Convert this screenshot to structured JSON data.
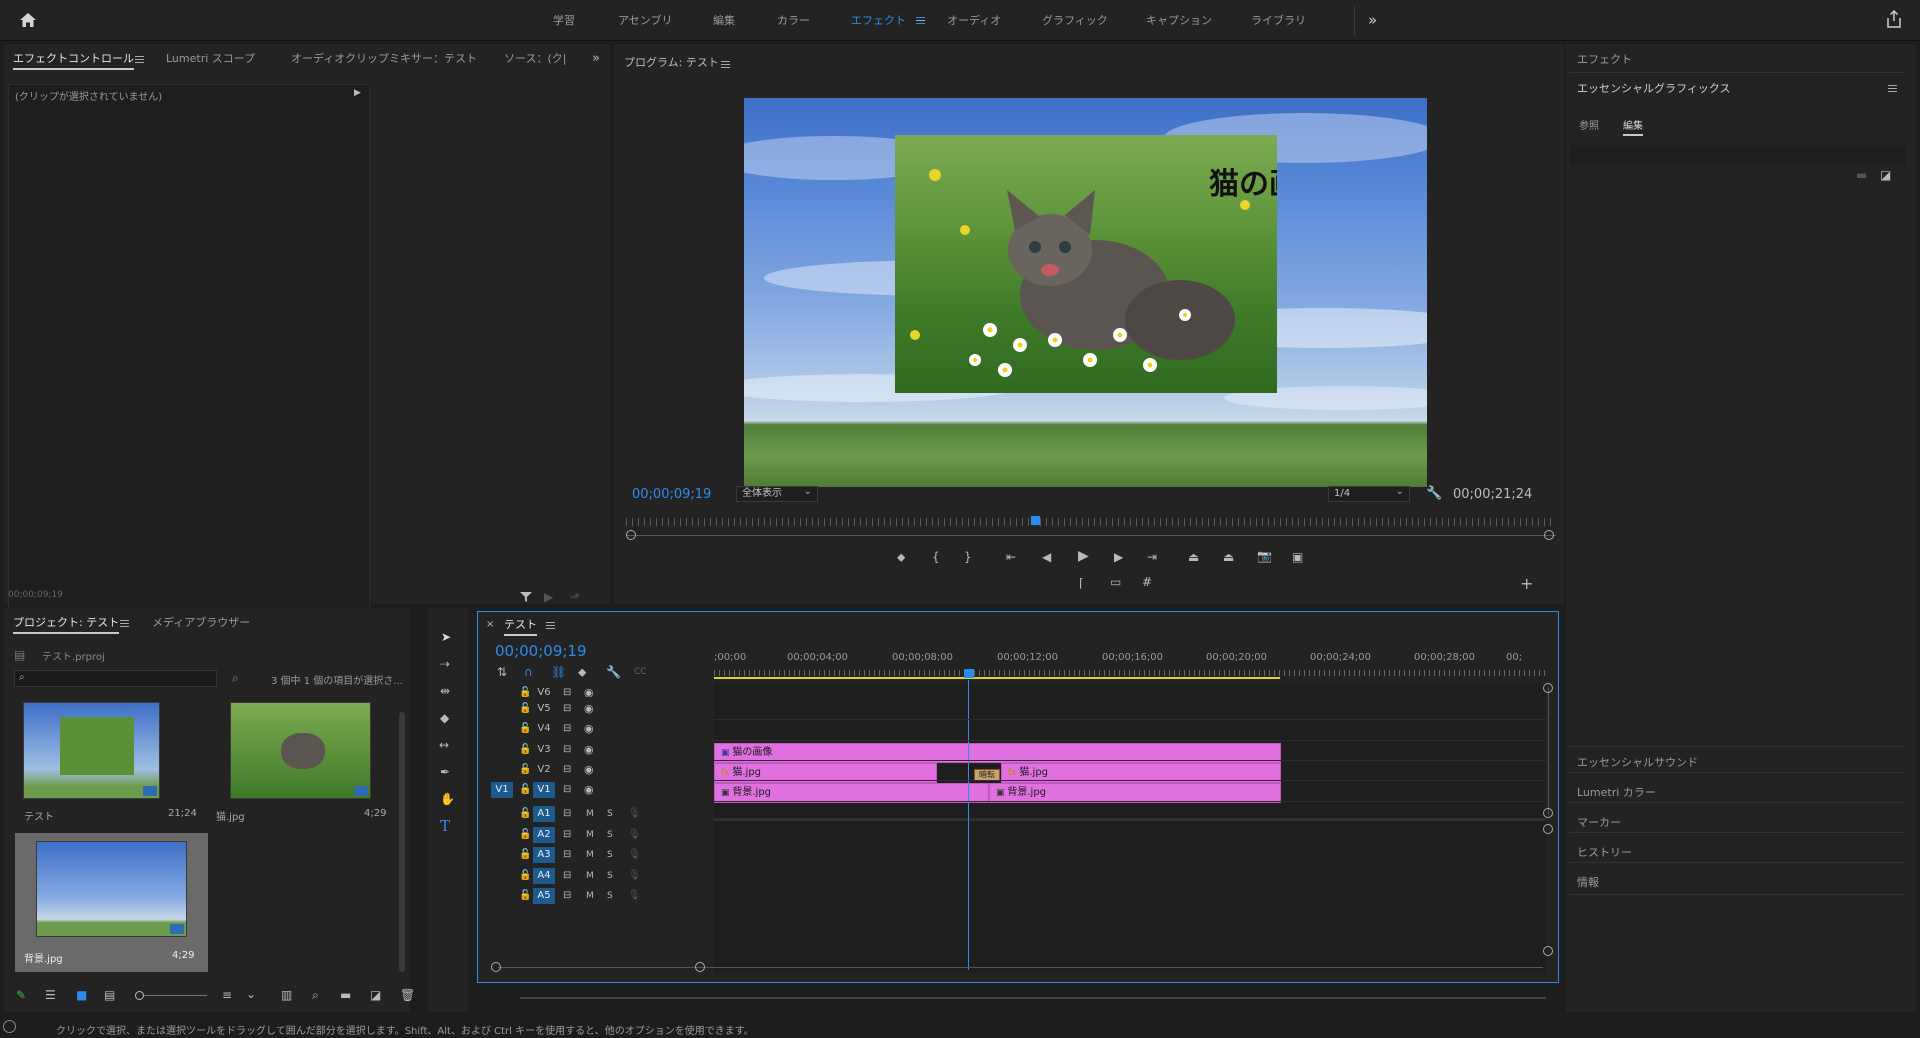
{
  "workspaces": [
    "学習",
    "アセンブリ",
    "編集",
    "カラー",
    "エフェクト",
    "オーディオ",
    "グラフィック",
    "キャプション",
    "ライブラリ"
  ],
  "active_workspace": "エフェクト",
  "more_workspaces": "»",
  "source_panel": {
    "tabs": [
      "エフェクトコントロール",
      "Lumetri スコープ",
      "オーディオクリップミキサー：テスト",
      "ソース：(ク|"
    ],
    "no_clip": "(クリップが選択されていません)",
    "timecode": "00;00;09;19"
  },
  "program": {
    "title": "プログラム: テスト",
    "overlay_text": "猫の画像",
    "current_tc": "00;00;09;19",
    "fit": "全体表示",
    "resolution": "1/4",
    "duration_tc": "00;00;21;24",
    "playhead_fraction": 0.44
  },
  "project": {
    "tabs": [
      "プロジェクト: テスト",
      "メディアブラウザー"
    ],
    "file": "テスト.prproj",
    "selection_info": "3 個中 1 個の項目が選択さ...",
    "items": [
      {
        "name": "テスト",
        "duration": "21;24"
      },
      {
        "name": "猫.jpg",
        "duration": "4;29"
      },
      {
        "name": "背景.jpg",
        "duration": "4;29"
      }
    ]
  },
  "timeline": {
    "tab": "テスト",
    "timecode": "00;00;09;19",
    "ruler": [
      ";00;00",
      "00;00;04;00",
      "00;00;08;00",
      "00;00;12;00",
      "00;00;16;00",
      "00;00;20;00",
      "00;00;24;00",
      "00;00;28;00",
      "00;"
    ],
    "video_tracks": [
      "V6",
      "V5",
      "V4",
      "V3",
      "V2",
      "V1"
    ],
    "audio_tracks": [
      "A1",
      "A2",
      "A3",
      "A4",
      "A5"
    ],
    "v1_source": "V1",
    "mute": "M",
    "solo": "S",
    "clips": {
      "v3": "猫の画像",
      "v2a": "猫.jpg",
      "v2b": "猫.jpg",
      "v1a": "背景.jpg",
      "v1b": "背景.jpg",
      "transition": "暗転"
    }
  },
  "right_panel": {
    "title": "エフェクト",
    "eg_title": "エッセンシャルグラフィックス",
    "eg_tabs": [
      "参照",
      "編集"
    ],
    "collapsed": [
      "エッセンシャルサウンド",
      "Lumetri カラー",
      "マーカー",
      "ヒストリー",
      "情報"
    ]
  },
  "status_bar": "クリックで選択、または選択ツールをドラッグして囲んだ部分を選択します。Shift、Alt、および Ctrl キーを使用すると、他のオプションを使用できます。",
  "colors": {
    "accent": "#2d8ceb",
    "clip": "#e06fe0",
    "work_area": "#e4d32a"
  }
}
